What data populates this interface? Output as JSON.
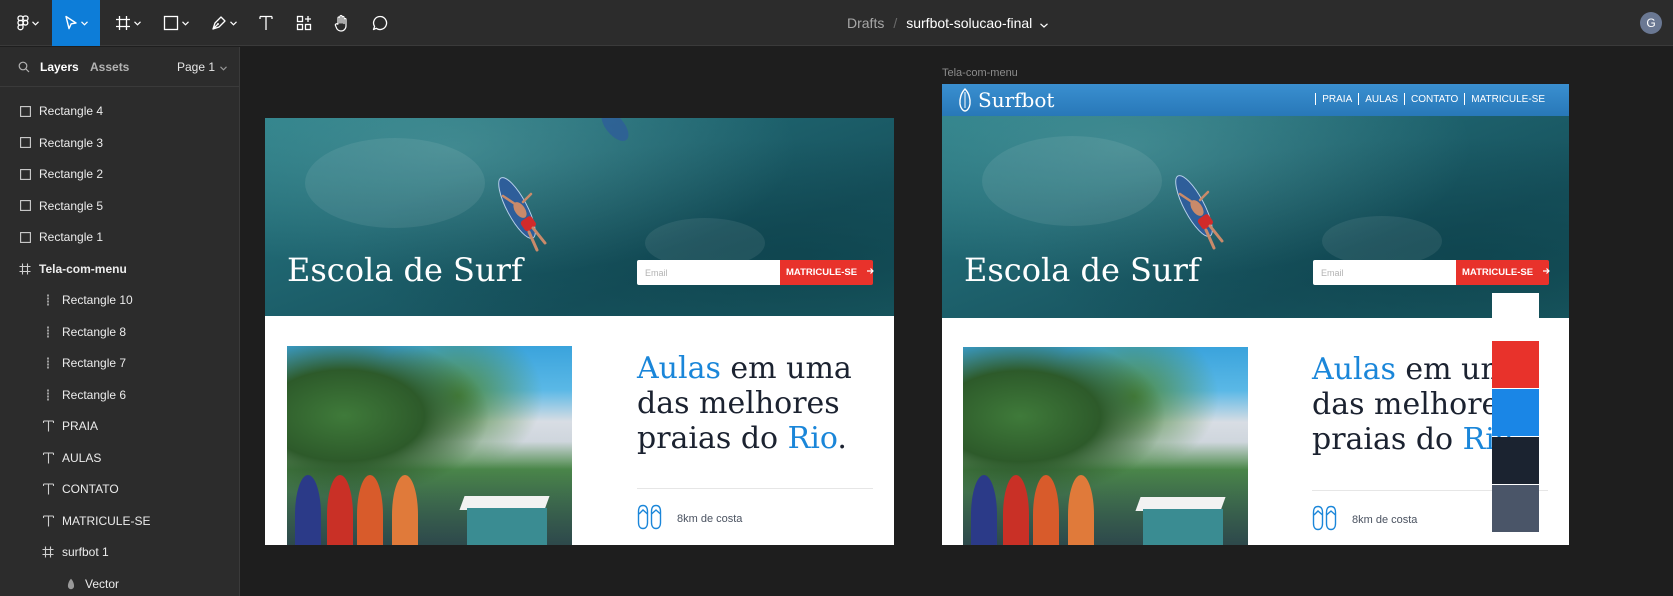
{
  "toolbar": {
    "breadcrumb_root": "Drafts",
    "breadcrumb_sep": "/",
    "file_name": "surfbot-solucao-final",
    "avatar_initial": "G",
    "tools": [
      "figma-menu-icon",
      "move-tool-icon",
      "frame-tool-icon",
      "rectangle-tool-icon",
      "pen-tool-icon",
      "text-tool-icon",
      "components-icon",
      "hand-tool-icon",
      "comment-icon"
    ]
  },
  "panel": {
    "tab_layers": "Layers",
    "tab_assets": "Assets",
    "page_select": "Page 1",
    "layers": [
      {
        "label": "Rectangle 4",
        "icon": "rectangle-icon"
      },
      {
        "label": "Rectangle 3",
        "icon": "rectangle-icon"
      },
      {
        "label": "Rectangle 2",
        "icon": "rectangle-icon"
      },
      {
        "label": "Rectangle 5",
        "icon": "rectangle-icon"
      },
      {
        "label": "Rectangle 1",
        "icon": "rectangle-icon"
      },
      {
        "label": "Tela-com-menu",
        "icon": "frame-icon"
      },
      {
        "label": "Rectangle 10",
        "icon": "line-icon"
      },
      {
        "label": "Rectangle 8",
        "icon": "line-icon"
      },
      {
        "label": "Rectangle 7",
        "icon": "line-icon"
      },
      {
        "label": "Rectangle 6",
        "icon": "line-icon"
      },
      {
        "label": "PRAIA",
        "icon": "text-icon"
      },
      {
        "label": "AULAS",
        "icon": "text-icon"
      },
      {
        "label": "CONTATO",
        "icon": "text-icon"
      },
      {
        "label": "MATRICULE-SE",
        "icon": "text-icon"
      },
      {
        "label": "surfbot 1",
        "icon": "frame-icon"
      },
      {
        "label": "Vector",
        "icon": "vector-icon"
      }
    ]
  },
  "canvas": {
    "frame_label": "Tela-com-menu",
    "site": {
      "hero_title": "Escola de Surf",
      "email_placeholder": "Email",
      "cta_label": "MATRICULE-SE",
      "headline_word1": "Aulas",
      "headline_mid": " em uma das melhores praias do ",
      "headline_word2": "Rio",
      "headline_end": ".",
      "feature_text": "8km de costa",
      "brand": "Surfbot",
      "nav": [
        "PRAIA",
        "AULAS",
        "CONTATO",
        "MATRICULE-SE"
      ]
    },
    "swatches": [
      "#ffffff",
      "#e8322b",
      "#1a86e6",
      "#1b2330",
      "#4a5568"
    ]
  },
  "colors": {
    "accent": "#0d7dd8",
    "cta_red": "#e8322b",
    "headline_blue": "#1a86d9",
    "text_dark": "#1b2230"
  }
}
